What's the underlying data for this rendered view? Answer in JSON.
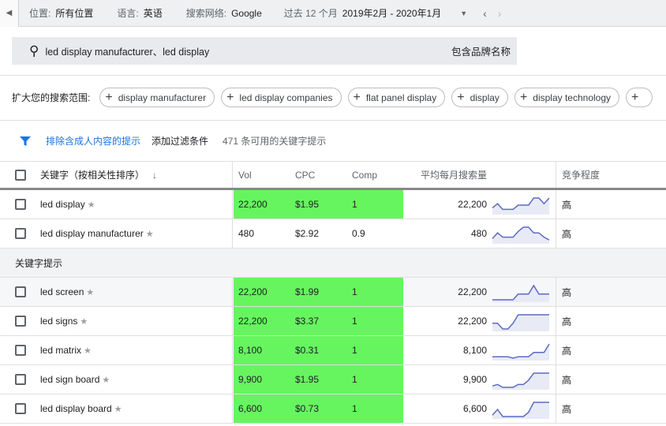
{
  "topbar": {
    "location_label": "位置:",
    "location": "所有位置",
    "language_label": "语言:",
    "language": "英语",
    "network_label": "搜索网络:",
    "network": "Google",
    "period_label": "过去 12 个月",
    "period": "2019年2月 - 2020年1月"
  },
  "search": {
    "query": "led display manufacturer、led display",
    "brand_toggle": "包含品牌名称"
  },
  "broaden": {
    "label": "扩大您的搜索范围:",
    "chips": [
      "display manufacturer",
      "led display companies",
      "flat panel display",
      "display",
      "display technology",
      ""
    ]
  },
  "filter": {
    "exclude_adult": "排除含成人内容的提示",
    "add_filter": "添加过滤条件",
    "count_text": "471 条可用的关键字提示"
  },
  "table": {
    "headers": {
      "keyword": "关键字（按相关性排序）",
      "vol": "Vol",
      "cpc": "CPC",
      "comp": "Comp",
      "avg": "平均每月搜索量",
      "competition": "竞争程度"
    },
    "highlight_color": "#66f55f",
    "trend_color": "#5c6bc0",
    "provided": [
      {
        "keyword": "led display",
        "vol": "22,200",
        "cpc": "$1.95",
        "comp": "1",
        "avg": "22,200",
        "competition": "高",
        "highlight": true,
        "trend": [
          0.3,
          0.6,
          0.2,
          0.2,
          0.2,
          0.5,
          0.5,
          0.5,
          1,
          1,
          0.6,
          1
        ]
      },
      {
        "keyword": "led display manufacturer",
        "vol": "480",
        "cpc": "$2.92",
        "comp": "0.9",
        "avg": "480",
        "competition": "高",
        "highlight": false,
        "trend": [
          0.2,
          0.6,
          0.3,
          0.3,
          0.3,
          0.7,
          1,
          1,
          0.6,
          0.6,
          0.3,
          0.1
        ]
      }
    ],
    "section_label": "关键字提示",
    "ideas": [
      {
        "keyword": "led screen",
        "vol": "22,200",
        "cpc": "$1.99",
        "comp": "1",
        "avg": "22,200",
        "competition": "高",
        "highlight": true,
        "trend": [
          0,
          0,
          0,
          0,
          0,
          0.4,
          0.4,
          0.4,
          1,
          0.4,
          0.4,
          0.4
        ]
      },
      {
        "keyword": "led signs",
        "vol": "22,200",
        "cpc": "$3.37",
        "comp": "1",
        "avg": "22,200",
        "competition": "高",
        "highlight": true,
        "trend": [
          0.4,
          0.4,
          0,
          0,
          0.4,
          1,
          1,
          1,
          1,
          1,
          1,
          1
        ]
      },
      {
        "keyword": "led matrix",
        "vol": "8,100",
        "cpc": "$0.31",
        "comp": "1",
        "avg": "8,100",
        "competition": "高",
        "highlight": true,
        "trend": [
          0.1,
          0.1,
          0.1,
          0.1,
          0,
          0.1,
          0.1,
          0.1,
          0.4,
          0.4,
          0.4,
          1
        ]
      },
      {
        "keyword": "led sign board",
        "vol": "9,900",
        "cpc": "$1.95",
        "comp": "1",
        "avg": "9,900",
        "competition": "高",
        "highlight": true,
        "trend": [
          0.1,
          0.2,
          0,
          0,
          0,
          0.2,
          0.2,
          0.5,
          1,
          1,
          1,
          1
        ]
      },
      {
        "keyword": "led display board",
        "vol": "6,600",
        "cpc": "$0.73",
        "comp": "1",
        "avg": "6,600",
        "competition": "高",
        "highlight": true,
        "trend": [
          0.1,
          0.5,
          0,
          0,
          0,
          0,
          0,
          0.3,
          1,
          1,
          1,
          1
        ]
      }
    ]
  }
}
